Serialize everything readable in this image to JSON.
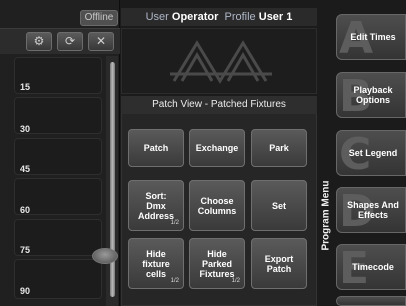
{
  "status": {
    "offline": "Offline"
  },
  "header": {
    "user_label": "User",
    "user_name": "Operator",
    "profile_label": "Profile",
    "profile_name": "User 1"
  },
  "toolbar": {
    "icons": [
      "gear-icon",
      "refresh-icon",
      "close-icon"
    ]
  },
  "left_panel": {
    "row_labels": [
      "15",
      "30",
      "45",
      "60",
      "75",
      "90"
    ]
  },
  "panel": {
    "title": "Patch View - Patched Fixtures",
    "buttons": [
      {
        "label": "Patch",
        "page": ""
      },
      {
        "label": "Exchange",
        "page": ""
      },
      {
        "label": "Park",
        "page": ""
      },
      {
        "label": "Sort: Dmx Address",
        "page": "1/2"
      },
      {
        "label": "Choose Columns",
        "page": ""
      },
      {
        "label": "Set",
        "page": ""
      },
      {
        "label": "Hide fixture cells",
        "page": "1/2"
      },
      {
        "label": "Hide Parked Fixtures",
        "page": "1/2"
      },
      {
        "label": "Export Patch",
        "page": ""
      }
    ]
  },
  "program_menu": {
    "label": "Program Menu",
    "items": [
      {
        "letter": "A",
        "label": "Edit Times"
      },
      {
        "letter": "B",
        "label": "Playback Options"
      },
      {
        "letter": "C",
        "label": "Set Legend"
      },
      {
        "letter": "D",
        "label": "Shapes And Effects"
      },
      {
        "letter": "E",
        "label": "Timecode"
      }
    ]
  }
}
